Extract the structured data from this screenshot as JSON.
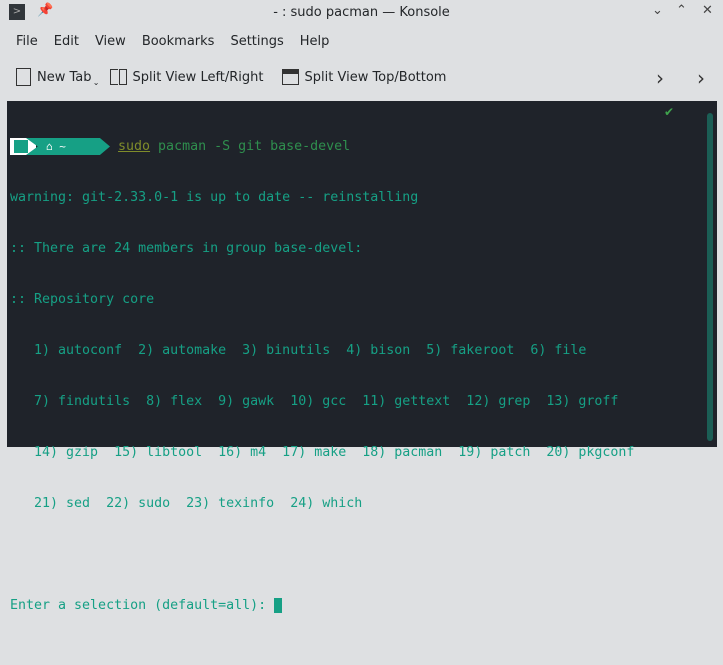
{
  "window": {
    "title": "- : sudo pacman — Konsole",
    "controls": [
      "⌄",
      "⌃",
      "✕"
    ]
  },
  "menu": [
    "File",
    "Edit",
    "View",
    "Bookmarks",
    "Settings",
    "Help"
  ],
  "toolbar": {
    "new_tab": "New Tab",
    "split_lr": "Split View Left/Right",
    "split_tb": "Split View Top/Bottom"
  },
  "terminal": {
    "prompt_dir": "~",
    "cmd_sudo": "sudo",
    "cmd_rest": " pacman -S git base-devel",
    "lines": [
      "warning: git-2.33.0-1 is up to date -- reinstalling",
      ":: There are 24 members in group base-devel:",
      ":: Repository core",
      "   1) autoconf  2) automake  3) binutils  4) bison  5) fakeroot  6) file",
      "   7) findutils  8) flex  9) gawk  10) gcc  11) gettext  12) grep  13) groff",
      "   14) gzip  15) libtool  16) m4  17) make  18) pacman  19) patch  20) pkgconf",
      "   21) sed  22) sudo  23) texinfo  24) which",
      ""
    ],
    "input_prompt": "Enter a selection (default=all): ",
    "status_check": "✔"
  }
}
